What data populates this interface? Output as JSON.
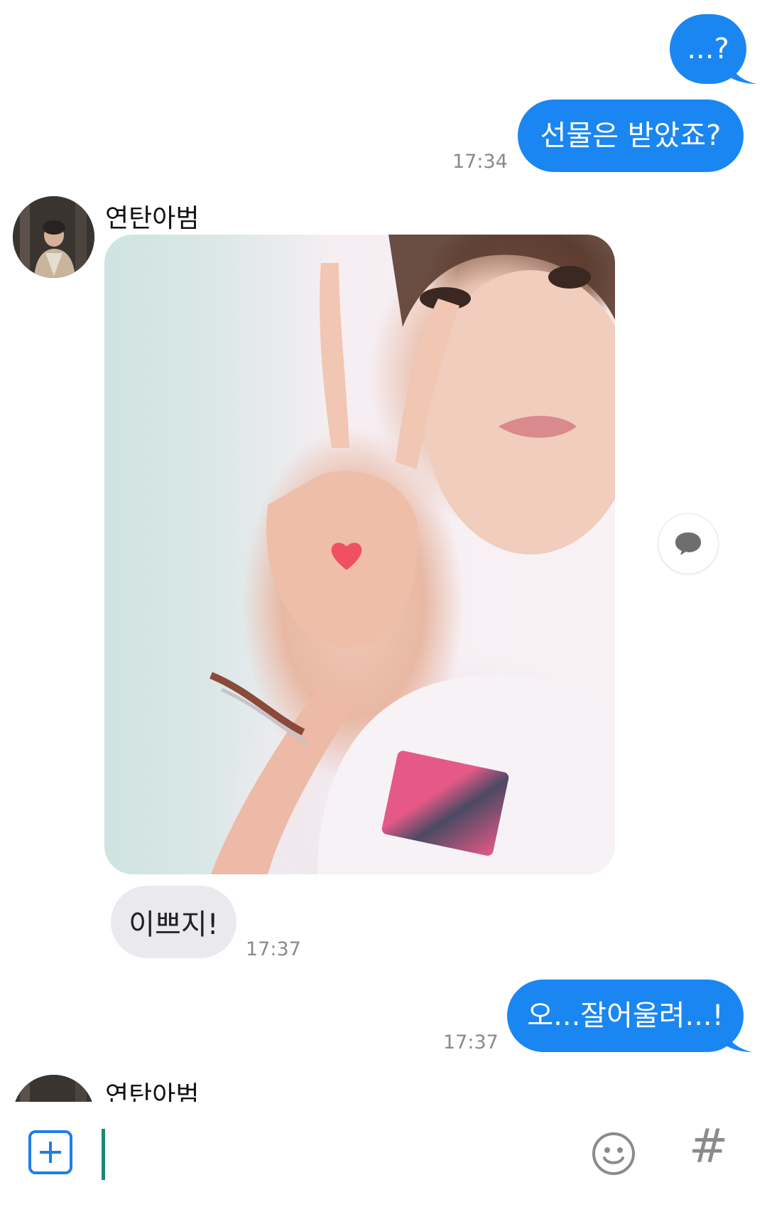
{
  "messages": [
    {
      "type": "out",
      "text": "...?"
    },
    {
      "type": "out",
      "text": "선물은 받았죠?",
      "time": "17:34"
    },
    {
      "type": "in_sender",
      "sender": "연탄아범"
    },
    {
      "type": "in_text",
      "text": "이쁘지!",
      "time": "17:37"
    },
    {
      "type": "out",
      "text": "오...잘어울려...!",
      "time": "17:37"
    },
    {
      "type": "in_sender",
      "sender": "연탄아범"
    }
  ],
  "icons": {
    "attach": "plus-square-icon",
    "emoji": "smiley-icon",
    "hashtag": "hash-icon",
    "reply": "speech-bubble-icon"
  },
  "colors": {
    "outgoing_bubble": "#1a86f2",
    "incoming_bubble": "#e9e9ee",
    "accent": "#1f7ee8",
    "cursor": "#1a8a6e"
  },
  "input": {
    "value": "",
    "placeholder": ""
  },
  "hashtag_symbol": "#"
}
